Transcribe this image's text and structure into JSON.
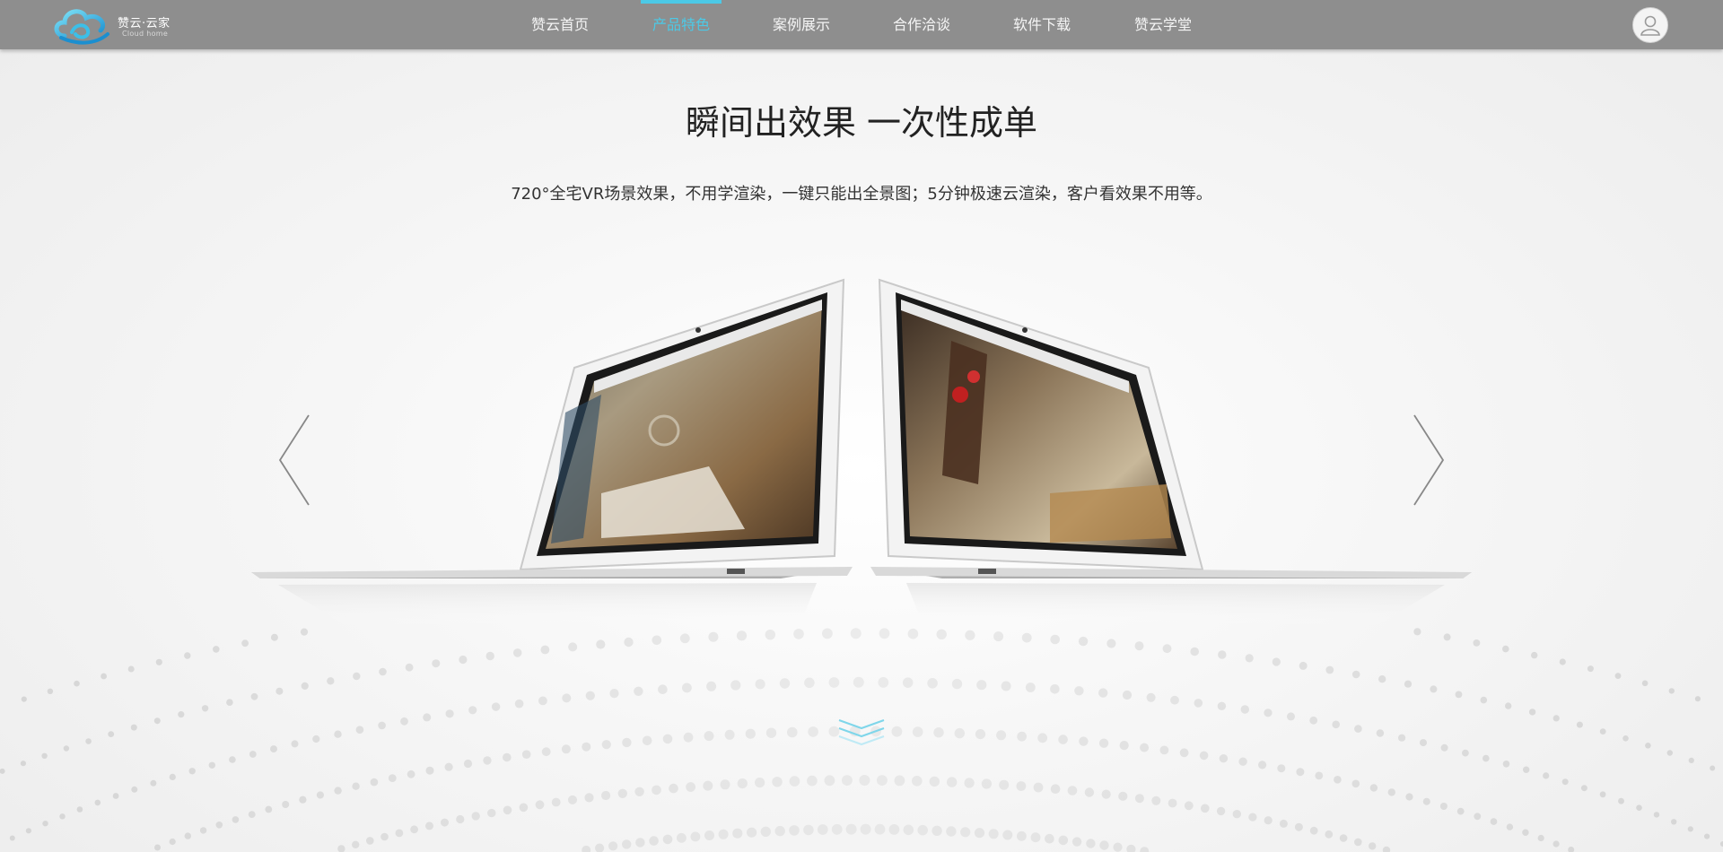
{
  "header": {
    "logo": {
      "name_cn": "赞云·云家",
      "name_en": "Cloud home",
      "icon": "cloud-logo-icon"
    },
    "nav": [
      {
        "label": "赞云首页",
        "active": false
      },
      {
        "label": "产品特色",
        "active": true
      },
      {
        "label": "案例展示",
        "active": false
      },
      {
        "label": "合作洽谈",
        "active": false
      },
      {
        "label": "软件下载",
        "active": false
      },
      {
        "label": "赞云学堂",
        "active": false
      }
    ],
    "user_icon": "user-icon"
  },
  "main": {
    "headline": "瞬间出效果 一次性成单",
    "subline": "720°全宅VR场景效果，不用学渲染，一键只能出全景图；5分钟极速云渲染，客户看效果不用等。",
    "carousel": {
      "prev_icon": "chevron-left-icon",
      "next_icon": "chevron-right-icon",
      "images": [
        "laptop-bedroom-panorama",
        "laptop-living-room-panorama"
      ]
    },
    "scroll_hint_icon": "double-chevron-down-icon"
  },
  "colors": {
    "header_bg": "#8e8e8e",
    "accent": "#4cc9e6",
    "text_dark": "#222222"
  }
}
